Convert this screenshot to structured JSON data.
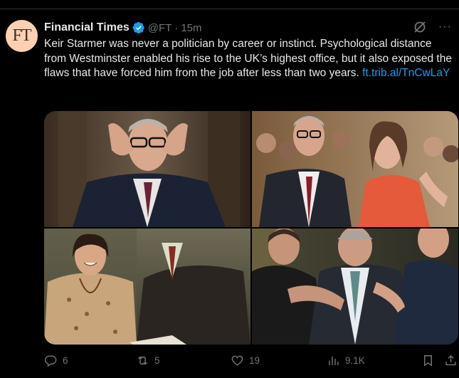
{
  "tweet": {
    "avatar_text": "FT",
    "display_name": "Financial Times",
    "handle": "@FT",
    "separator": "·",
    "time": "15m",
    "text": "Keir Starmer was never a politician by career or instinct. Psychological distance from Westminster enabled his rise to the UK’s highest office, but it also exposed the flaws that have forced him from the job after less than two years.",
    "link": "ft.trib.al/TnCwLaY"
  },
  "actions": {
    "replies": "6",
    "reposts": "5",
    "likes": "19",
    "views": "9.1K"
  },
  "icons": {
    "verified": "verified-badge-icon",
    "grok": "grok-icon",
    "more": "more-icon",
    "reply": "reply-icon",
    "repost": "repost-icon",
    "like": "heart-icon",
    "views": "views-icon",
    "bookmark": "bookmark-icon",
    "share": "share-icon"
  },
  "colors": {
    "background": "#000000",
    "text": "#e7e9ea",
    "muted": "#71767b",
    "link": "#1d9bf0",
    "verified": "#1d9bf0",
    "avatar_bg": "#fcd0b1"
  }
}
